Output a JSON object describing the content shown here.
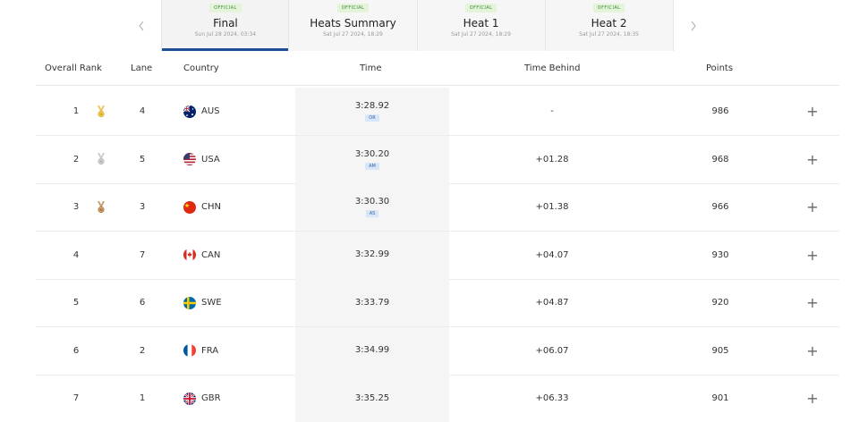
{
  "tabs": [
    {
      "badge": "OFFICIAL",
      "title": "Final",
      "date": "Sun Jul 28 2024, 03:34",
      "active": true
    },
    {
      "badge": "OFFICIAL",
      "title": "Heats Summary",
      "date": "Sat Jul 27 2024, 18:29",
      "active": false
    },
    {
      "badge": "OFFICIAL",
      "title": "Heat 1",
      "date": "Sat Jul 27 2024, 18:29",
      "active": false
    },
    {
      "badge": "OFFICIAL",
      "title": "Heat 2",
      "date": "Sat Jul 27 2024, 18:35",
      "active": false
    }
  ],
  "nav": {
    "prev_icon": "chevron-left-icon",
    "next_icon": "chevron-right-icon"
  },
  "table": {
    "headers": {
      "rank": "Overall Rank",
      "lane": "Lane",
      "country": "Country",
      "time": "Time",
      "behind": "Time Behind",
      "points": "Points"
    },
    "rows": [
      {
        "rank": "1",
        "medal": "gold",
        "lane": "4",
        "country": "AUS",
        "time": "3:28.92",
        "record": "OR",
        "behind": "-",
        "points": "986"
      },
      {
        "rank": "2",
        "medal": "silver",
        "lane": "5",
        "country": "USA",
        "time": "3:30.20",
        "record": "AM",
        "behind": "+01.28",
        "points": "968"
      },
      {
        "rank": "3",
        "medal": "bronze",
        "lane": "3",
        "country": "CHN",
        "time": "3:30.30",
        "record": "AS",
        "behind": "+01.38",
        "points": "966"
      },
      {
        "rank": "4",
        "medal": "",
        "lane": "7",
        "country": "CAN",
        "time": "3:32.99",
        "record": "",
        "behind": "+04.07",
        "points": "930"
      },
      {
        "rank": "5",
        "medal": "",
        "lane": "6",
        "country": "SWE",
        "time": "3:33.79",
        "record": "",
        "behind": "+04.87",
        "points": "920"
      },
      {
        "rank": "6",
        "medal": "",
        "lane": "2",
        "country": "FRA",
        "time": "3:34.99",
        "record": "",
        "behind": "+06.07",
        "points": "905"
      },
      {
        "rank": "7",
        "medal": "",
        "lane": "1",
        "country": "GBR",
        "time": "3:35.25",
        "record": "",
        "behind": "+06.33",
        "points": "901"
      }
    ],
    "expand_icon": "plus-icon"
  },
  "colors": {
    "active_tab_underline": "#1f4e96",
    "official_badge_bg": "#e3f4d8",
    "record_badge_bg": "#d7e6f8",
    "gold": "#e0b020",
    "silver": "#b8b8b8",
    "bronze": "#b07a3a"
  }
}
